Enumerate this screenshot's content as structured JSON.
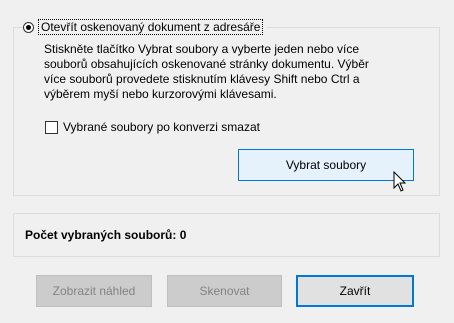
{
  "option": {
    "label": "Otevřít oskenovaný dokument z adresáře",
    "description_lines": [
      "Stiskněte tlačítko Vybrat soubory a vyberte jeden nebo více",
      "souborů obsahujících oskenované stránky dokumentu. Výběr",
      "více souborů provedete stisknutím klávesy Shift nebo Ctrl a",
      "výběrem myší nebo kurzorovými klávesami."
    ],
    "delete_checkbox_label": "Vybrané soubory po konverzi smazat",
    "select_button": "Vybrat soubory"
  },
  "status": {
    "count_text": "Počet vybraných souborů: 0"
  },
  "footer": {
    "preview_button": "Zobrazit náhled",
    "scan_button": "Skenovat",
    "close_button": "Zavřít"
  }
}
